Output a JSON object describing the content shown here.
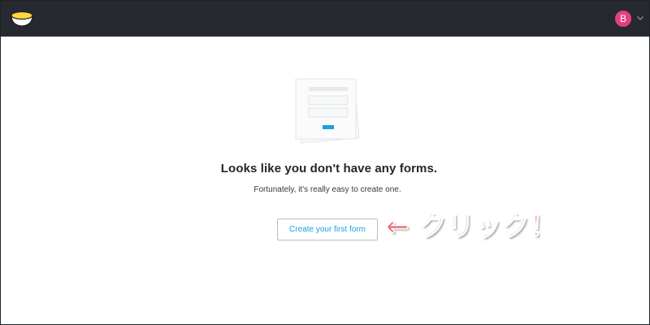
{
  "header": {
    "logo_icon": "bowl-logo-icon",
    "user": {
      "avatar_initial": "B",
      "avatar_color": "#e5407e",
      "menu_icon": "chevron-down-icon"
    }
  },
  "empty_state": {
    "illustration_icon": "form-document-icon",
    "heading": "Looks like you don't have any forms.",
    "subtext": "Fortunately, it's really easy to create one.",
    "create_button_label": "Create your first form"
  },
  "annotation": {
    "text": "← クリック！",
    "color": "#f06d76"
  },
  "colors": {
    "topbar": "#262a30",
    "accent": "#1aa4d6",
    "logo_yellow": "#ffd73a"
  }
}
